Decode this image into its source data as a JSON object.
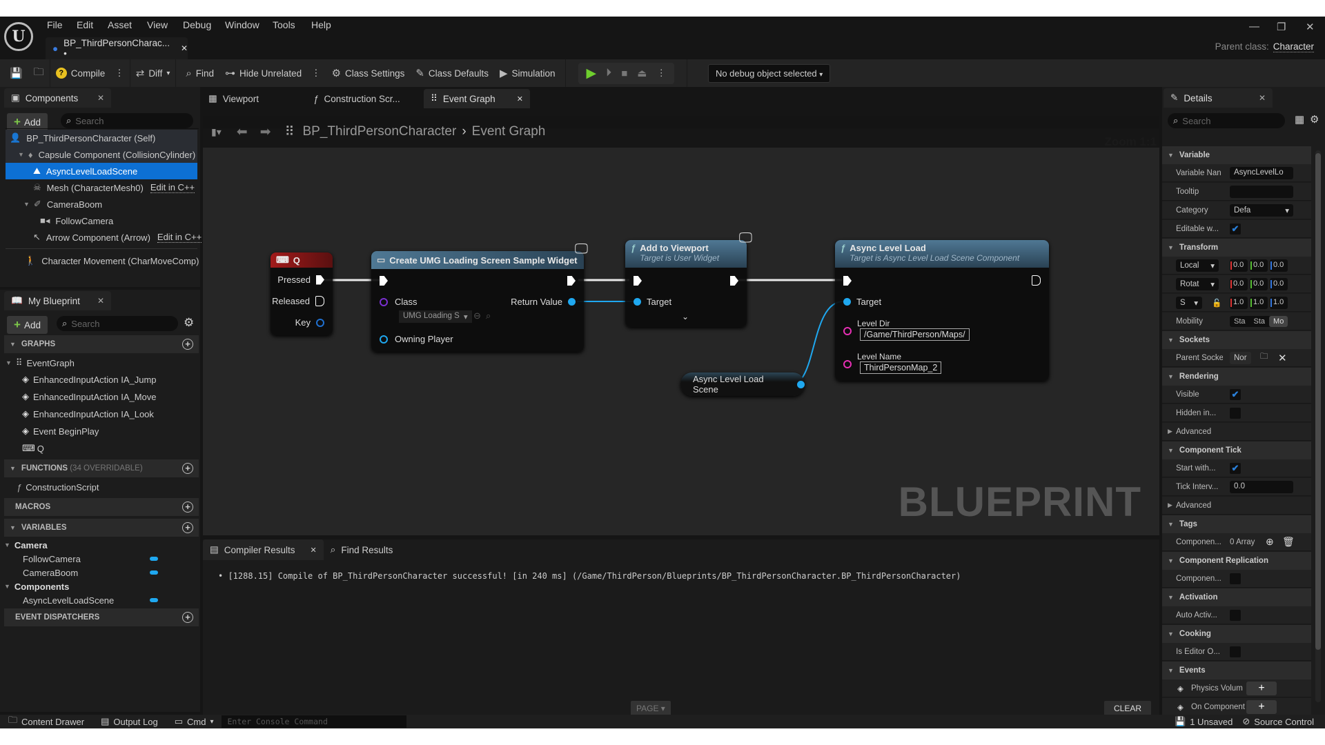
{
  "app": {
    "logo": "U",
    "menu": [
      "File",
      "Edit",
      "Asset",
      "View",
      "Debug",
      "Window",
      "Tools",
      "Help"
    ],
    "asset_tab": "BP_ThirdPersonCharac... •",
    "parent_class_label": "Parent class:",
    "parent_class_value": "Character"
  },
  "toolbar": {
    "compile": "Compile",
    "diff": "Diff",
    "find": "Find",
    "hide_unrelated": "Hide Unrelated",
    "class_settings": "Class Settings",
    "class_defaults": "Class Defaults",
    "simulation": "Simulation",
    "debug_object": "No debug object selected"
  },
  "components_panel": {
    "title": "Components",
    "add": "Add",
    "search_placeholder": "Search",
    "items": [
      {
        "label": "BP_ThirdPersonCharacter (Self)"
      },
      {
        "label": "Capsule Component (CollisionCylinder)"
      },
      {
        "label": "AsyncLevelLoadScene",
        "selected": true
      },
      {
        "label": "Mesh (CharacterMesh0)",
        "link": "Edit in C++"
      },
      {
        "label": "CameraBoom"
      },
      {
        "label": "FollowCamera"
      },
      {
        "label": "Arrow Component (Arrow)",
        "link": "Edit in C++"
      },
      {
        "label": "Character Movement (CharMoveComp)"
      }
    ]
  },
  "my_blueprint": {
    "title": "My Blueprint",
    "add": "Add",
    "search_placeholder": "Search",
    "graphs_header": "GRAPHS",
    "graphs": [
      "EventGraph",
      "EnhancedInputAction IA_Jump",
      "EnhancedInputAction IA_Move",
      "EnhancedInputAction IA_Look",
      "Event BeginPlay",
      "Q"
    ],
    "functions_header": "FUNCTIONS",
    "functions_count": "(34 OVERRIDABLE)",
    "functions": [
      "ConstructionScript"
    ],
    "macros_header": "MACROS",
    "variables_header": "VARIABLES",
    "var_cat_camera": "Camera",
    "var_camera": [
      "FollowCamera",
      "CameraBoom"
    ],
    "var_cat_components": "Components",
    "var_components": [
      "AsyncLevelLoadScene"
    ],
    "dispatchers_header": "EVENT DISPATCHERS"
  },
  "editor_tabs": [
    "Viewport",
    "Construction Scr...",
    "Event Graph"
  ],
  "breadcrumb": {
    "root": "BP_ThirdPersonCharacter",
    "current": "Event Graph"
  },
  "graph": {
    "zoom": "Zoom 1:1",
    "watermark": "BLUEPRINT",
    "node_q": {
      "title": "Q",
      "pins": [
        "Pressed",
        "Released",
        "Key"
      ]
    },
    "node_create": {
      "title": "Create UMG Loading Screen Sample Widget",
      "class_label": "Class",
      "class_value": "UMG Loading S",
      "owning_player": "Owning Player",
      "return_value": "Return Value"
    },
    "node_add": {
      "title": "Add to Viewport",
      "subtitle": "Target is User Widget",
      "target": "Target"
    },
    "node_async": {
      "title": "Async Level Load",
      "subtitle": "Target is Async Level Load Scene Component",
      "target": "Target",
      "level_dir_label": "Level Dir",
      "level_dir": "/Game/ThirdPerson/Maps/",
      "level_name_label": "Level Name",
      "level_name": "ThirdPersonMap_2"
    },
    "node_var": {
      "title": "Async Level Load Scene"
    },
    "colors": {
      "exec": "#ffffff",
      "object_pin": "#1fa8f0",
      "class_pin": "#7a2fd0",
      "string_pin": "#e62fb4",
      "event_header": "#9b1c1c",
      "function_header": "#3d6a8c"
    }
  },
  "compiler": {
    "tab": "Compiler Results",
    "find_tab": "Find Results",
    "message": "[1288.15] Compile of BP_ThirdPersonCharacter successful! [in 240 ms] (/Game/ThirdPerson/Blueprints/BP_ThirdPersonCharacter.BP_ThirdPersonCharacter)",
    "page": "PAGE",
    "clear": "CLEAR"
  },
  "details": {
    "title": "Details",
    "search_placeholder": "Search",
    "variable": "Variable",
    "variable_name_label": "Variable Nan",
    "variable_name": "AsyncLevelLo",
    "tooltip_label": "Tooltip",
    "category_label": "Category",
    "category_value": "Defa",
    "editable_label": "Editable w...",
    "transform": "Transform",
    "location_mode": "Local",
    "rotation_mode": "Rotat",
    "scale_mode": "S",
    "loc": [
      "0.0",
      "0.0",
      "0.0"
    ],
    "rot": [
      "0.0",
      "0.0",
      "0.0"
    ],
    "scale": [
      "1.0",
      "1.0",
      "1.0"
    ],
    "mobility_label": "Mobility",
    "mobility": [
      "Sta",
      "Sta",
      "Mo"
    ],
    "sockets": "Sockets",
    "parent_socket_label": "Parent Socke",
    "parent_socket": "Nor",
    "rendering": "Rendering",
    "visible_label": "Visible",
    "hidden_label": "Hidden in...",
    "advanced": "Advanced",
    "component_tick": "Component Tick",
    "start_with_label": "Start with...",
    "tick_interval_label": "Tick Interv...",
    "tick_interval": "0.0",
    "tags": "Tags",
    "component_tags_label": "Componen...",
    "component_tags": "0 Array",
    "component_replication": "Component Replication",
    "replicates_label": "Componen...",
    "activation": "Activation",
    "auto_activate_label": "Auto Activ...",
    "cooking": "Cooking",
    "is_editor_label": "Is Editor O...",
    "events": "Events",
    "event1": "Physics Volum",
    "event2": "On Component"
  },
  "statusbar": {
    "content_drawer": "Content Drawer",
    "output_log": "Output Log",
    "cmd": "Cmd",
    "console_placeholder": "Enter Console Command",
    "unsaved": "1 Unsaved",
    "source_control": "Source Control"
  }
}
